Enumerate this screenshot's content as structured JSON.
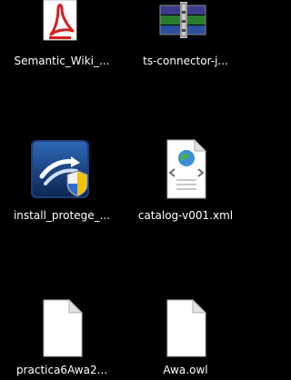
{
  "desktop": {
    "icons": [
      {
        "label": "Semantic_Wiki_...",
        "icon": "pdf-document-icon"
      },
      {
        "label": "ts-connector-j...",
        "icon": "archive-icon"
      },
      {
        "label": "install_protege_...",
        "icon": "installer-icon"
      },
      {
        "label": "catalog-v001.xml",
        "icon": "xml-document-icon"
      },
      {
        "label": "practica6Awa2...",
        "icon": "blank-document-icon"
      },
      {
        "label": "Awa.owl",
        "icon": "blank-document-icon"
      }
    ]
  },
  "colors": {
    "background": "#000000",
    "pdf_red": "#d42020",
    "installer_blue": "#1a3f7a"
  }
}
